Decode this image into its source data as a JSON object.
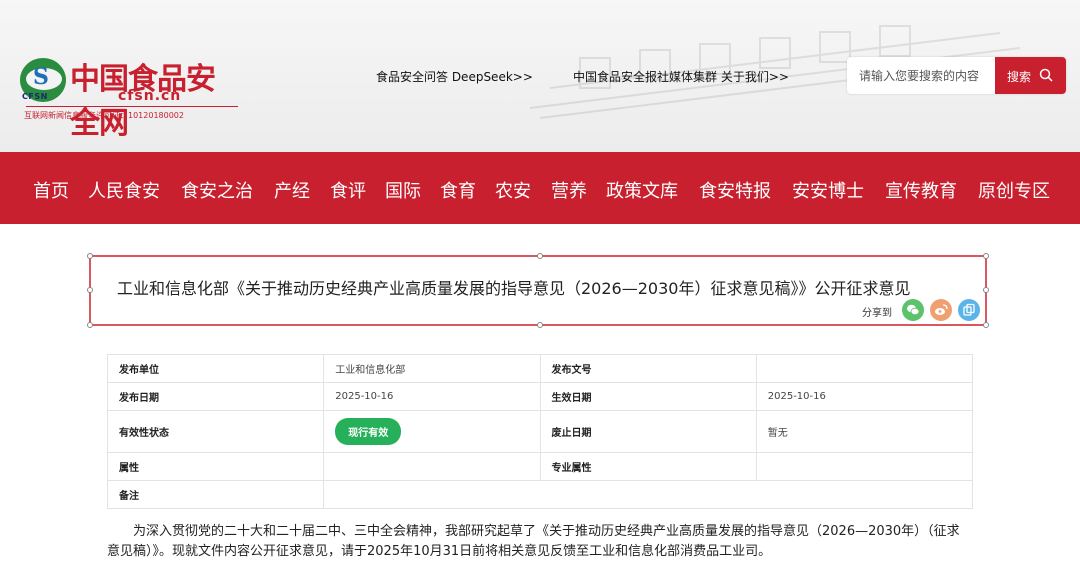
{
  "site": {
    "logo_cn": "中国食品安全网",
    "logo_en": "cfsn.cn",
    "logo_abbr": "CFSN",
    "license": "互联网新闻信息服务许可证：10120180002"
  },
  "toplinks": {
    "deepseek": "食品安全问答 DeepSeek>>",
    "media": "中国食品安全报社媒体集群 关于我们>>"
  },
  "search": {
    "placeholder": "请输入您要搜索的内容",
    "button_label": "搜索"
  },
  "nav": {
    "items": [
      "首页",
      "人民食安",
      "食安之治",
      "产经",
      "食评",
      "国际",
      "食育",
      "农安",
      "营养",
      "政策文库",
      "食安特报",
      "安安博士",
      "宣传教育",
      "原创专区"
    ]
  },
  "article": {
    "title": "工业和信息化部《关于推动历史经典产业高质量发展的指导意见（2026—2030年）征求意见稿》》公开征求意见",
    "share_label": "分享到"
  },
  "info": {
    "publisher_label": "发布单位",
    "publisher_value": "工业和信息化部",
    "doc_no_label": "发布文号",
    "doc_no_value": "",
    "publish_date_label": "发布日期",
    "publish_date_value": "2025-10-16",
    "effective_date_label": "生效日期",
    "effective_date_value": "2025-10-16",
    "validity_label": "有效性状态",
    "validity_value": "现行有效",
    "abolish_date_label": "废止日期",
    "abolish_date_value": "暂无",
    "attribute_label": "属性",
    "attribute_value": "",
    "special_attribute_label": "专业属性",
    "special_attribute_value": "",
    "remark_label": "备注",
    "remark_value": ""
  },
  "body_text": "为深入贯彻党的二十大和二十届二中、三中全会精神，我部研究起草了《关于推动历史经典产业高质量发展的指导意见（2026—2030年）（征求意见稿）》。现就文件内容公开征求意见，请于2025年10月31日前将相关意见反馈至工业和信息化部消费品工业司。",
  "colors": {
    "brand_red": "#c8202f",
    "badge_green": "#27b05a",
    "wechat": "#5cc26b",
    "weibo": "#f0a070",
    "copy": "#5ab4e8"
  }
}
